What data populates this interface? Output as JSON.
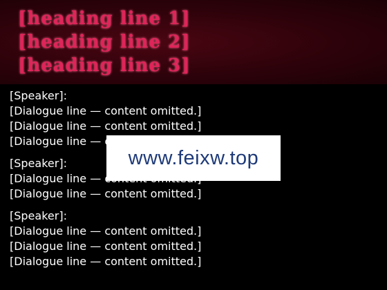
{
  "banner": {
    "lines": [
      "[heading line 1]",
      "[heading line 2]",
      "[heading line 3]"
    ]
  },
  "dialogue": [
    {
      "speaker": "[Speaker]:",
      "lines": [
        "[Dialogue line — content omitted.]",
        "[Dialogue line — content omitted.]",
        "[Dialogue line — content omitted.]"
      ]
    },
    {
      "speaker": "[Speaker]:",
      "lines": [
        "[Dialogue line — content omitted.]",
        "[Dialogue line — content omitted.]"
      ]
    },
    {
      "speaker": "[Speaker]:",
      "lines": [
        "[Dialogue line — content omitted.]",
        "[Dialogue line — content omitted.]",
        "[Dialogue line — content omitted.]"
      ]
    }
  ],
  "watermark": {
    "text": "www.feixw.top"
  }
}
